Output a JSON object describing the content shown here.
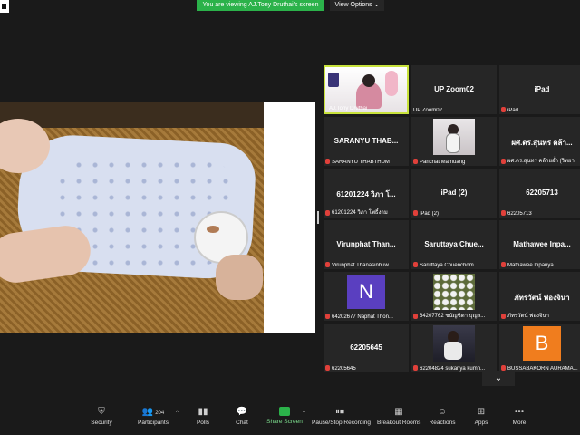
{
  "banner": {
    "viewing": "You are viewing AJ.Tony Druthai's screen"
  },
  "view_options": {
    "label": "View Options ⌄"
  },
  "gallery": {
    "tiles": [
      {
        "label": "AJ.Tony Druthai",
        "kind": "host"
      },
      {
        "name": "UP Zoom02",
        "label": "UP Zoom02"
      },
      {
        "name": "iPad",
        "label": "iPad"
      },
      {
        "name": "SARANYU THAB...",
        "label": "SARANYU THABTHUM"
      },
      {
        "label": "Parichat Mamuang",
        "kind": "photo"
      },
      {
        "name": "ผศ.ดร.สุนทร คล้า...",
        "label": "ผศ.ดร.สุนทร คล้ายอ่ำ (วิทยา"
      },
      {
        "name": "61201224 วิภา โ...",
        "label": "61201224 วิภา โพธิ์งาม"
      },
      {
        "name": "iPad (2)",
        "label": "iPad (2)"
      },
      {
        "name": "62205713",
        "label": "62205713"
      },
      {
        "name": "Virunphat Than...",
        "label": "Virunphat Thanasinbuw..."
      },
      {
        "name": "Saruttaya Chue...",
        "label": "Saruttaya Chuenchom"
      },
      {
        "name": "Mathawee Inpa...",
        "label": "Mathawee Inpanya"
      },
      {
        "label": "64202677 Naphat Thon...",
        "letter": "N",
        "kind": "letter",
        "color": "#5a3fc0"
      },
      {
        "label": "64207762 ชนัญชิดา บุญส...",
        "kind": "flowers"
      },
      {
        "name": "ภัทรวัตน์ ฟองจินา",
        "label": "ภัทรวัตน์ ฟองจินา"
      },
      {
        "name": "62205645",
        "label": "62205645"
      },
      {
        "label": "62204824 sukanya kumn...",
        "kind": "photo2"
      },
      {
        "label": "BUSSABAKORN AURAMA...",
        "letter": "B",
        "kind": "letter",
        "color": "#f07d1e"
      }
    ]
  },
  "toolbar": {
    "security": "Security",
    "participants": "Participants",
    "participants_count": "204",
    "polls": "Polls",
    "chat": "Chat",
    "share_screen": "Share Screen",
    "pause_recording": "Pause/Stop Recording",
    "breakout_rooms": "Breakout Rooms",
    "reactions": "Reactions",
    "apps": "Apps",
    "more": "More"
  },
  "icons": {
    "security": "shield-icon",
    "participants": "people-icon",
    "polls": "bar-chart-icon",
    "chat": "chat-bubble-icon",
    "share_screen": "share-arrow-icon",
    "recording": "pause-stop-icon",
    "breakout": "grid-icon",
    "reactions": "smiley-icon",
    "apps": "apps-icon",
    "more": "ellipsis-icon"
  },
  "colors": {
    "accent_green": "#2bb24a",
    "active_speaker": "#c8e23c",
    "muted_red": "#e0403a"
  }
}
